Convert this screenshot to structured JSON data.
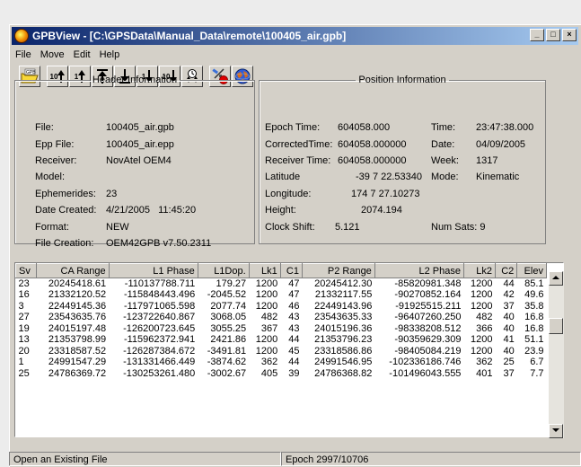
{
  "window": {
    "title": "GPBView - [C:\\GPSData\\Manual_Data\\remote\\100405_air.gpb]",
    "minimize": "_",
    "maximize": "□",
    "close": "×"
  },
  "menu": [
    "File",
    "Move",
    "Edit",
    "Help"
  ],
  "toolbar": {
    "open": "GPB",
    "step_up_10": "10",
    "step_up_1": "1",
    "step_down_1": "1",
    "step_down_10": "10"
  },
  "header_info": {
    "legend": "Header Information",
    "fields": [
      {
        "label": "File:",
        "value": "100405_air.gpb"
      },
      {
        "label": "Epp File:",
        "value": "100405_air.epp"
      },
      {
        "label": "Receiver:",
        "value": "NovAtel OEM4"
      },
      {
        "label": "Model:",
        "value": ""
      },
      {
        "label": "Ephemerides:",
        "value": "23"
      },
      {
        "label": "Date Created:",
        "value": "4/21/2005   11:45:20"
      },
      {
        "label": "Format:",
        "value": "NEW"
      },
      {
        "label": "File Creation:",
        "value": "OEM42GPB v7.50.2311"
      }
    ]
  },
  "position_info": {
    "legend": "Position Information",
    "epoch_time_label": "Epoch Time:",
    "epoch_time": "604058.000",
    "corrected_time_label": "CorrectedTime:",
    "corrected_time": "604058.000000",
    "receiver_time_label": "Receiver Time:",
    "receiver_time": "604058.000000",
    "latitude_label": "Latitude",
    "latitude": "-39 7 22.53340",
    "longitude_label": "Longitude:",
    "longitude": "174 7 27.10273",
    "height_label": "Height:",
    "height": "2074.194",
    "clock_shift_label": "Clock Shift:",
    "clock_shift": "5.121",
    "time_label": "Time:",
    "time": "23:47:38.000",
    "date_label": "Date:",
    "date": "04/09/2005",
    "week_label": "Week:",
    "week": "1317",
    "mode_label": "Mode:",
    "mode": "Kinematic",
    "num_sats": "Num Sats: 9"
  },
  "table": {
    "columns": [
      "Sv",
      "CA Range",
      "L1 Phase",
      "L1Dop.",
      "Lk1",
      "C1",
      "P2 Range",
      "L2 Phase",
      "Lk2",
      "C2",
      "Elev"
    ],
    "rows": [
      [
        "23",
        "20245418.61",
        "-110137788.711",
        "179.27",
        "1200",
        "47",
        "20245412.30",
        "-85820981.348",
        "1200",
        "44",
        "85.1"
      ],
      [
        "16",
        "21332120.52",
        "-115848443.496",
        "-2045.52",
        "1200",
        "47",
        "21332117.55",
        "-90270852.164",
        "1200",
        "42",
        "49.6"
      ],
      [
        "3",
        "22449145.36",
        "-117971065.598",
        "2077.74",
        "1200",
        "46",
        "22449143.96",
        "-91925515.211",
        "1200",
        "37",
        "35.8"
      ],
      [
        "27",
        "23543635.76",
        "-123722640.867",
        "3068.05",
        "482",
        "43",
        "23543635.33",
        "-96407260.250",
        "482",
        "40",
        "16.8"
      ],
      [
        "19",
        "24015197.48",
        "-126200723.645",
        "3055.25",
        "367",
        "43",
        "24015196.36",
        "-98338208.512",
        "366",
        "40",
        "16.8"
      ],
      [
        "13",
        "21353798.99",
        "-115962372.941",
        "2421.86",
        "1200",
        "44",
        "21353796.23",
        "-90359629.309",
        "1200",
        "41",
        "51.1"
      ],
      [
        "20",
        "23318587.52",
        "-126287384.672",
        "-3491.81",
        "1200",
        "45",
        "23318586.86",
        "-98405084.219",
        "1200",
        "40",
        "23.9"
      ],
      [
        "1",
        "24991547.29",
        "-131331466.449",
        "-3874.62",
        "362",
        "44",
        "24991546.95",
        "-102336186.746",
        "362",
        "25",
        "6.7"
      ],
      [
        "25",
        "24786369.72",
        "-130253261.480",
        "-3002.67",
        "405",
        "39",
        "24786368.82",
        "-101496043.555",
        "401",
        "37",
        "7.7"
      ]
    ]
  },
  "status": {
    "left": "Open an Existing File",
    "right": "Epoch 2997/10706"
  }
}
